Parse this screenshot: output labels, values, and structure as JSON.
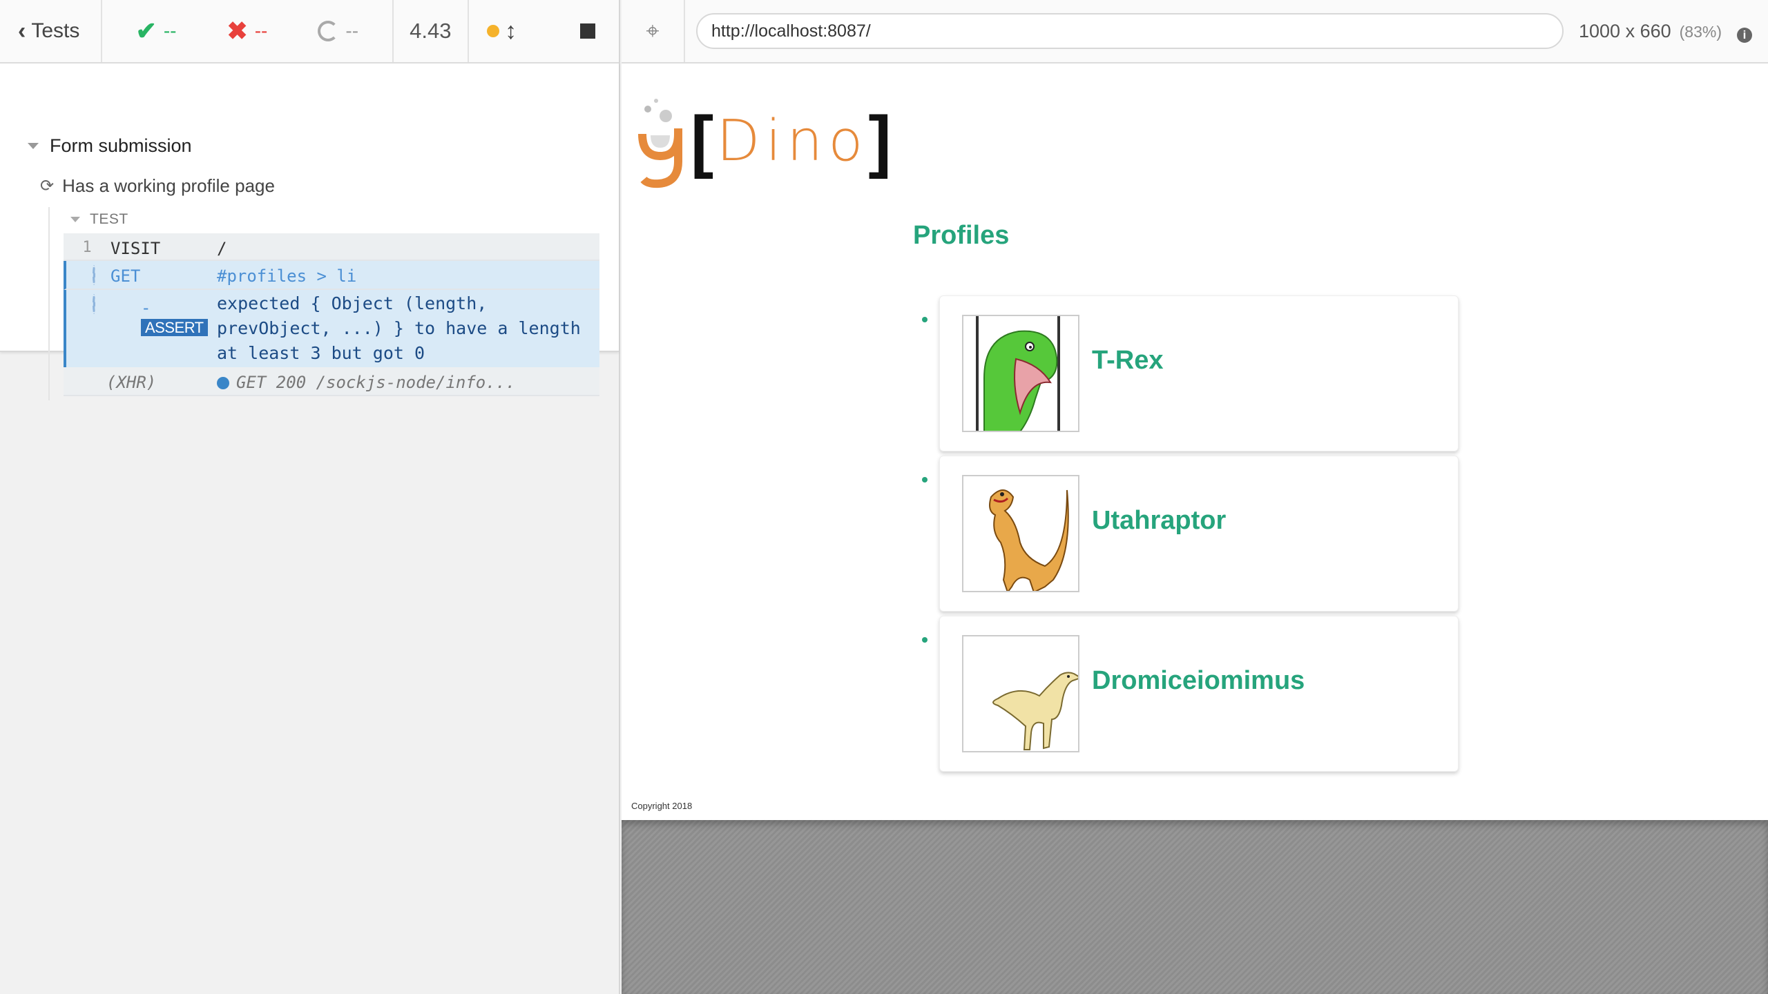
{
  "reporter": {
    "back_label": "Tests",
    "stats": {
      "passed": "--",
      "failed": "--",
      "pending": "--"
    },
    "duration": "4.43",
    "suite_title": "Form submission",
    "test_title": "Has a working profile page",
    "section_label": "TEST",
    "commands": [
      {
        "number": "1",
        "name": "VISIT",
        "message": "/"
      },
      {
        "number": "",
        "name": "GET",
        "message": "#profiles > li"
      },
      {
        "number": "",
        "name": "ASSERT",
        "prefix": "-",
        "message": "expected { Object (length, prevObject, ...) } to have a length at least 3 but got 0"
      },
      {
        "number": "",
        "name": "(XHR)",
        "message": "GET 200 /sockjs-node/info..."
      }
    ]
  },
  "aut": {
    "url": "http://localhost:8087/",
    "viewport": "1000 x 660",
    "scale": "(83%)",
    "info_icon": "i"
  },
  "app": {
    "logo_text": "Dino",
    "logo_brackets": [
      "[",
      "]"
    ],
    "heading": "Profiles",
    "profiles": [
      {
        "name": "T-Rex",
        "icon": "t-rex-image"
      },
      {
        "name": "Utahraptor",
        "icon": "utahraptor-image"
      },
      {
        "name": "Dromiceiomimus",
        "icon": "dromiceiomimus-image"
      }
    ],
    "copyright": "Copyright 2018"
  },
  "colors": {
    "accent_green": "#26a47c",
    "logo_orange": "#e68a3b",
    "pass": "#28b463",
    "fail": "#e8413c",
    "pending_blue": "#3a86c8"
  }
}
